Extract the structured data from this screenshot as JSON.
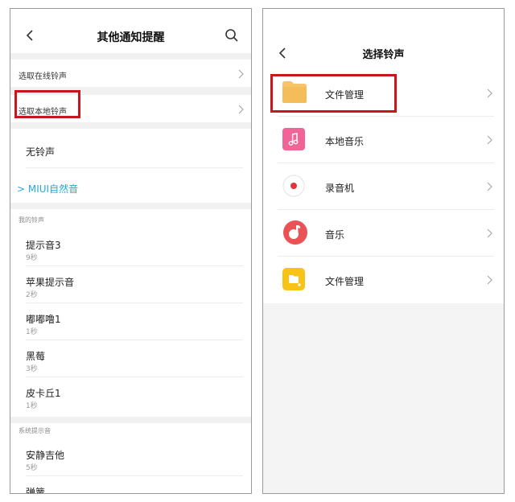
{
  "left": {
    "title": "其他通知提醒",
    "online_ringtone": "选取在线铃声",
    "local_ringtone": "选取本地铃声",
    "no_ringtone": "无铃声",
    "miui_sound": "MIUI自然音",
    "my_ringtones_header": "我的铃声",
    "my_ringtones": [
      {
        "name": "提示音3",
        "duration": "9秒"
      },
      {
        "name": "苹果提示音",
        "duration": "2秒"
      },
      {
        "name": "嘟嘟噜1",
        "duration": "1秒"
      },
      {
        "name": "黑莓",
        "duration": "3秒"
      },
      {
        "name": "皮卡丘1",
        "duration": "1秒"
      }
    ],
    "system_header": "系统提示音",
    "system_ringtones": [
      {
        "name": "安静吉他",
        "duration": "5秒"
      },
      {
        "name": "弹簧",
        "duration": ""
      }
    ]
  },
  "right": {
    "title": "选择铃声",
    "items": [
      {
        "label": "文件管理",
        "icon": "folder-icon"
      },
      {
        "label": "本地音乐",
        "icon": "music-note-icon"
      },
      {
        "label": "录音机",
        "icon": "recorder-icon"
      },
      {
        "label": "音乐",
        "icon": "music-app-icon"
      },
      {
        "label": "文件管理",
        "icon": "file-manager-icon"
      }
    ]
  },
  "colors": {
    "highlight_border": "#c8161d",
    "miui_accent": "#2aa6d8",
    "folder": "#f7c46a",
    "music_pink": "#f06595",
    "recorder_red": "#e0363a",
    "music_app_red": "#ea5256",
    "file_manager_yellow": "#f7c318"
  }
}
